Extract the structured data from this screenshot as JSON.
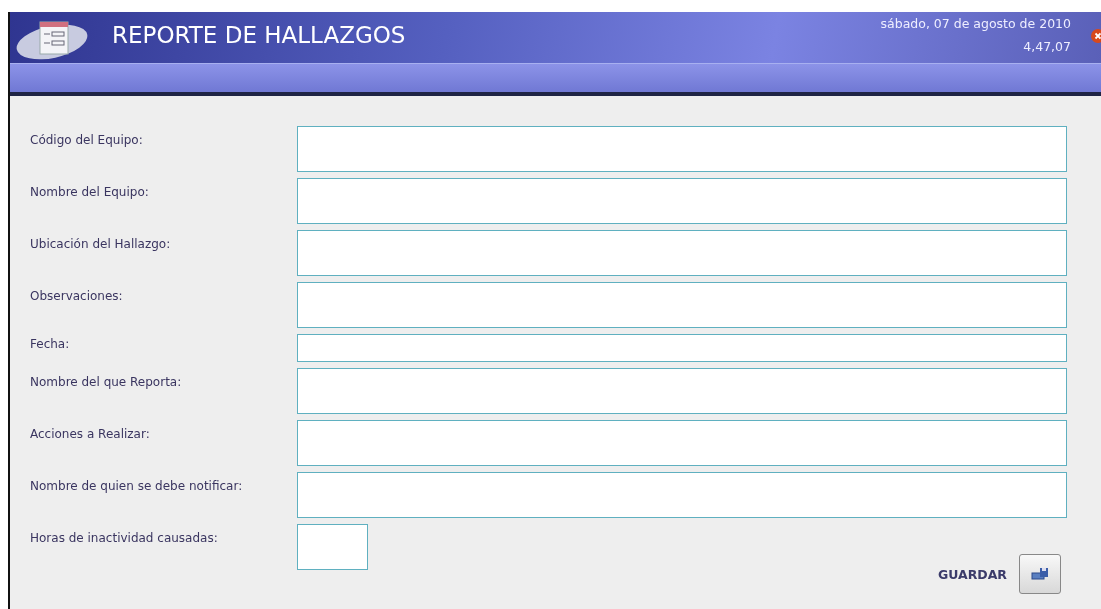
{
  "window": {
    "title": "REPORTE DE HALLAZGOS",
    "date": "sábado, 07 de agosto de 2010",
    "time": "4,47,07"
  },
  "fields": [
    {
      "label": "Código del Equipo:",
      "kind": "tall"
    },
    {
      "label": "Nombre del Equipo:",
      "kind": "tall"
    },
    {
      "label": "Ubicación del Hallazgo:",
      "kind": "tall"
    },
    {
      "label": "Observaciones:",
      "kind": "tall"
    },
    {
      "label": "Fecha:",
      "kind": "short"
    },
    {
      "label": "Nombre del que Reporta:",
      "kind": "tall"
    },
    {
      "label": "Acciones a Realizar:",
      "kind": "tall"
    },
    {
      "label": "Nombre de quien se debe notificar:",
      "kind": "tall"
    },
    {
      "label": "Horas de inactividad causadas:",
      "kind": "small"
    }
  ],
  "save": {
    "label": "GUARDAR"
  }
}
